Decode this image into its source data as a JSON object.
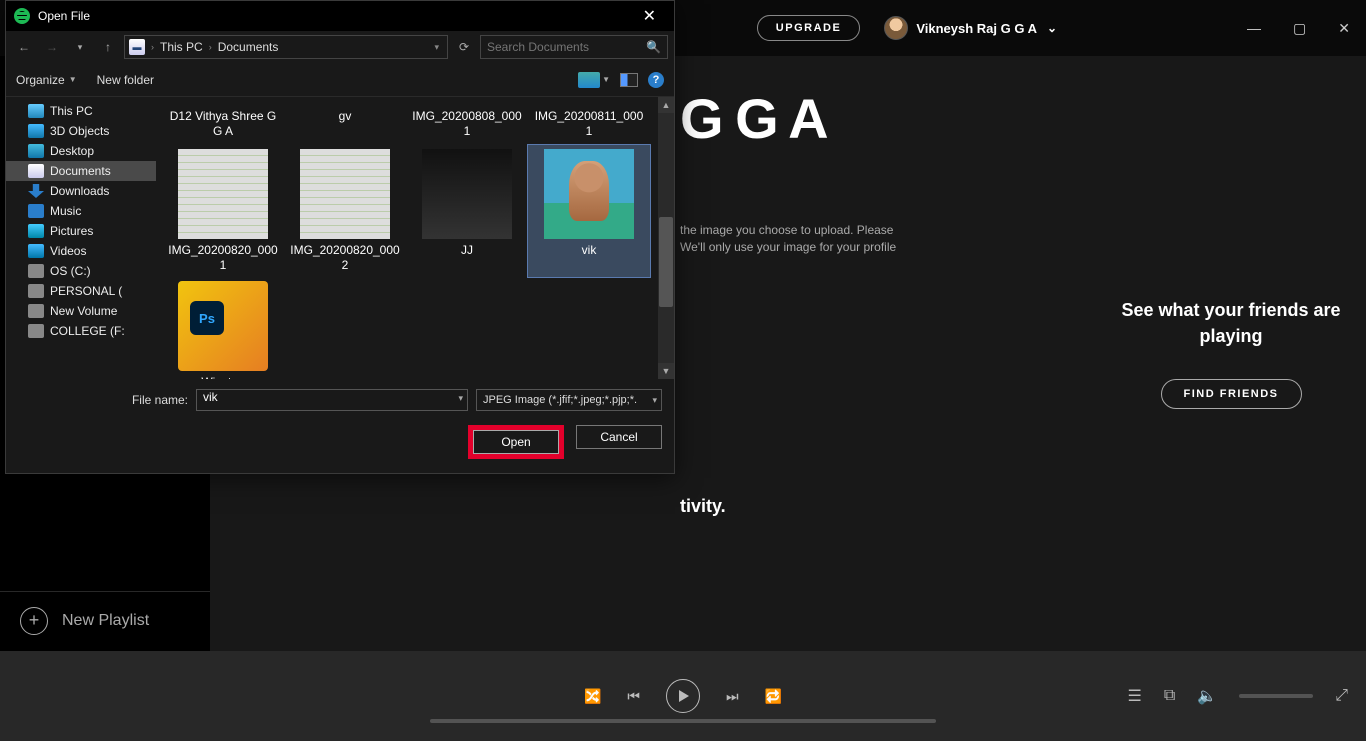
{
  "spotify": {
    "upgrade": "UPGRADE",
    "user_name": "Vikneysh Raj G G A",
    "big_title": "G G A",
    "bg_line1": "the image you choose to upload. Please",
    "bg_line2": "We'll only use your image for your profile",
    "bg_line3": "tivity.",
    "right_title": "See what your friends are playing",
    "find_friends": "FIND FRIENDS",
    "new_playlist": "New Playlist"
  },
  "dialog": {
    "title": "Open File",
    "breadcrumb": {
      "root": "This PC",
      "folder": "Documents"
    },
    "search_placeholder": "Search Documents",
    "toolbar": {
      "organize": "Organize",
      "new_folder": "New folder"
    },
    "tree": [
      {
        "label": "This PC",
        "ico": "ico-pc"
      },
      {
        "label": "3D Objects",
        "ico": "ico-3d"
      },
      {
        "label": "Desktop",
        "ico": "ico-desk"
      },
      {
        "label": "Documents",
        "ico": "ico-doc",
        "active": true
      },
      {
        "label": "Downloads",
        "ico": "ico-dl"
      },
      {
        "label": "Music",
        "ico": "ico-music"
      },
      {
        "label": "Pictures",
        "ico": "ico-pic"
      },
      {
        "label": "Videos",
        "ico": "ico-vid"
      },
      {
        "label": "OS (C:)",
        "ico": "ico-disk"
      },
      {
        "label": "PERSONAL (",
        "ico": "ico-disk"
      },
      {
        "label": "New Volume",
        "ico": "ico-disk"
      },
      {
        "label": "COLLEGE (F:",
        "ico": "ico-disk"
      }
    ],
    "files_row0": [
      {
        "label": "D12 Vithya Shree G G A"
      },
      {
        "label": "gv"
      },
      {
        "label": "IMG_20200808_0001"
      },
      {
        "label": "IMG_20200811_0001"
      }
    ],
    "files": [
      {
        "label": "IMG_20200820_0001",
        "thumb": "paper"
      },
      {
        "label": "IMG_20200820_0002",
        "thumb": "paper"
      },
      {
        "label": "JJ",
        "thumb": "dark"
      },
      {
        "label": "vik",
        "thumb": "vik",
        "selected": true
      },
      {
        "label": "Winstep",
        "thumb": "ws"
      }
    ],
    "file_name_label": "File name:",
    "file_name_value": "vik",
    "filter": "JPEG Image (*.jfif;*.jpeg;*.pjp;*.",
    "open": "Open",
    "cancel": "Cancel"
  }
}
